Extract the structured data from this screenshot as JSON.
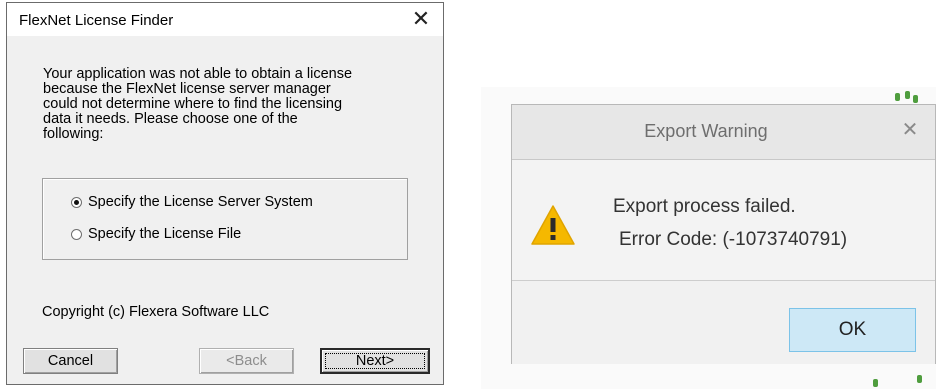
{
  "flexnet_dialog": {
    "title": "FlexNet License Finder",
    "close_glyph": "✕",
    "message_lines": [
      "Your application was not able to obtain a license",
      "because the FlexNet license server manager",
      "could not determine where to find the licensing",
      "data it needs.  Please choose one of the",
      "following:"
    ],
    "options": [
      {
        "label": "Specify the License Server System",
        "selected": true
      },
      {
        "label": "Specify the License File",
        "selected": false
      }
    ],
    "copyright": "Copyright (c) Flexera Software LLC",
    "buttons": {
      "cancel": "Cancel",
      "back": "<Back",
      "back_enabled": false,
      "next": "Next>"
    }
  },
  "export_dialog": {
    "title": "Export Warning",
    "close_glyph": "✕",
    "icon": "warning-icon",
    "message_line1": "Export process failed.",
    "message_line2": "Error Code: (-1073740791)",
    "ok_label": "OK",
    "colors": {
      "warning_icon": "#f5b800",
      "ok_background": "#cde8f6",
      "ok_border": "#7cc3e8"
    }
  }
}
